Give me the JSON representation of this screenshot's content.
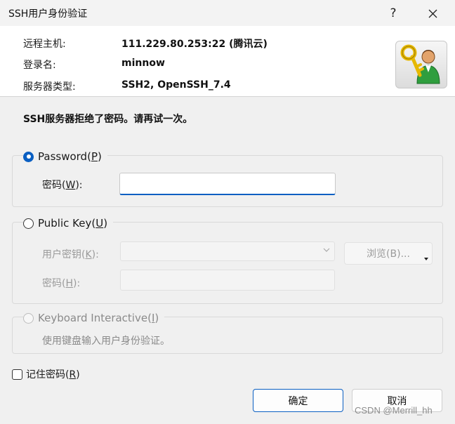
{
  "window": {
    "title": "SSH用户身份验证",
    "help_glyph": "?"
  },
  "info": {
    "host_label": "远程主机:",
    "host_value": "111.229.80.253:22 (腾讯云)",
    "user_label": "登录名:",
    "user_value": "minnow",
    "server_label": "服务器类型:",
    "server_value": "SSH2, OpenSSH_7.4",
    "icon": "key-user-icon"
  },
  "message": "SSH服务器拒绝了密码。请再试一次。",
  "password_group": {
    "label": "Password",
    "mnemonic": "P",
    "selected": true,
    "field_label": "密码",
    "field_mnemonic": "W",
    "field_value": ""
  },
  "pubkey_group": {
    "label": "Public Key",
    "mnemonic": "U",
    "selected": false,
    "userkey_label": "用户密钥",
    "userkey_mnemonic": "K",
    "userkey_value": "",
    "browse_label": "浏览(B)...",
    "passphrase_label": "密码",
    "passphrase_mnemonic": "H"
  },
  "keyboard_group": {
    "label": "Keyboard Interactive",
    "mnemonic": "I",
    "selected": false,
    "description": "使用键盘输入用户身份验证。"
  },
  "remember": {
    "label": "记住密码",
    "mnemonic": "R",
    "checked": false
  },
  "buttons": {
    "ok": "确定",
    "cancel": "取消"
  },
  "watermark": "CSDN @Merrill_hh",
  "colors": {
    "accent": "#0a5fc2",
    "background": "#f0f0f0"
  }
}
